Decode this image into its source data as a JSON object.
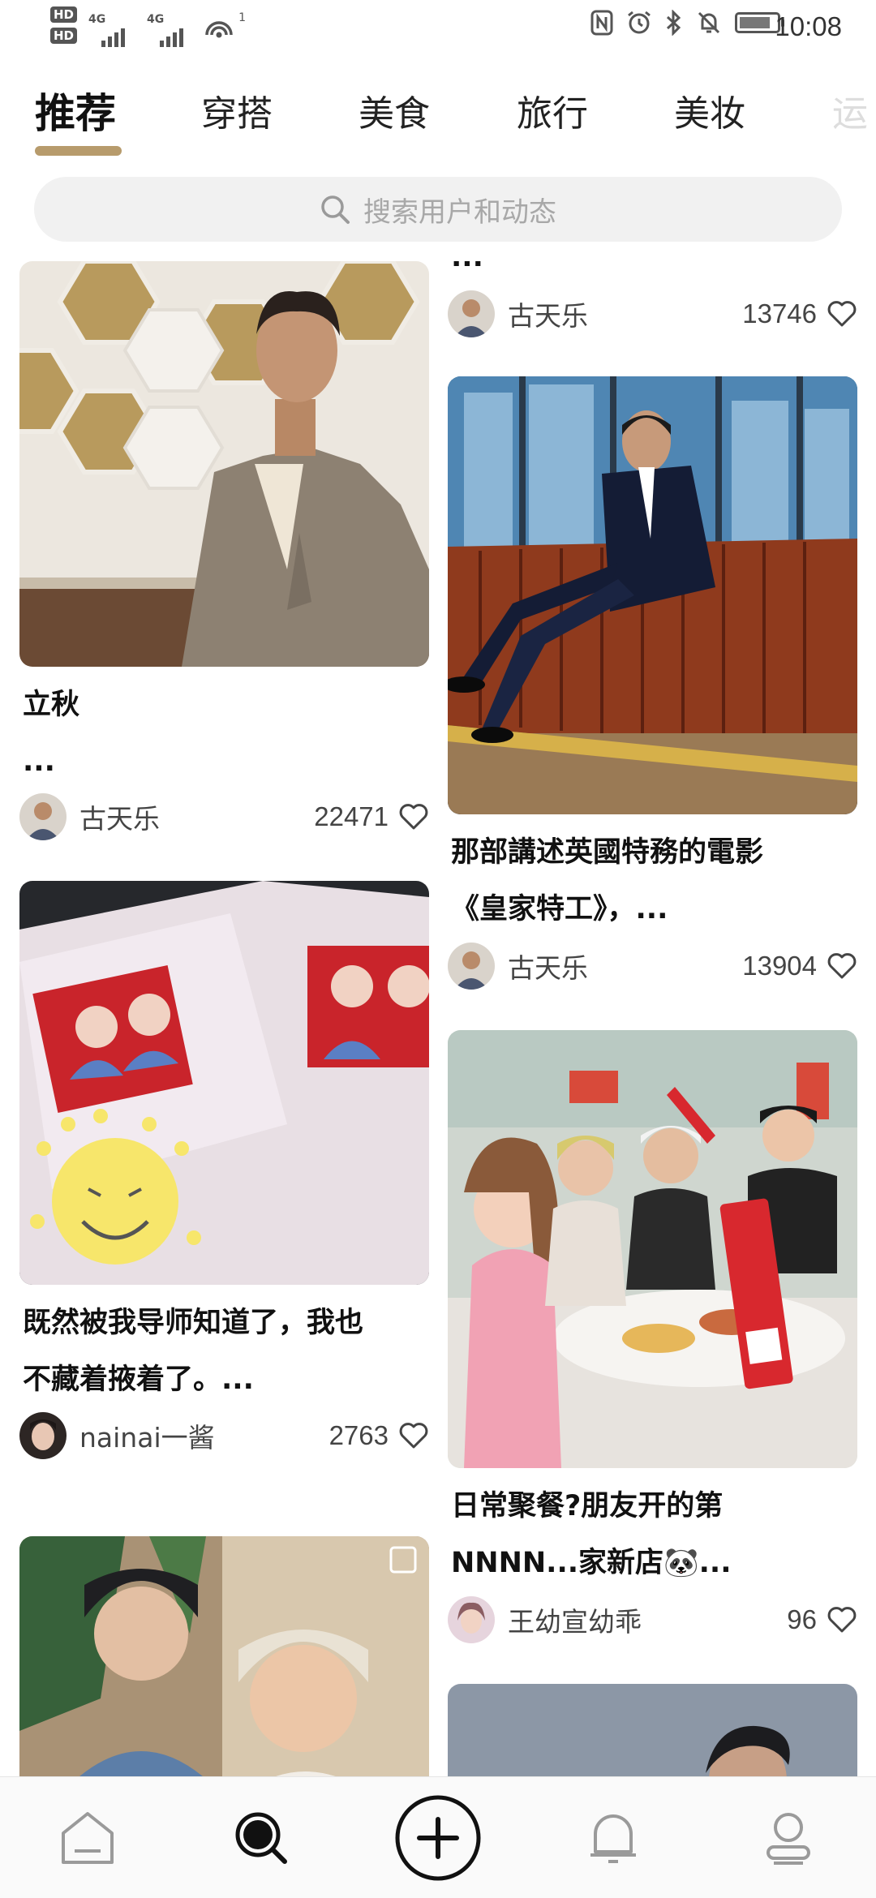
{
  "status_bar": {
    "hd1": "HD",
    "hd2": "HD",
    "net1": "4G",
    "net2": "4G",
    "wifi_badge": "1",
    "time": "10:08",
    "battery_level": 0.85
  },
  "tabs": [
    {
      "label": "推荐",
      "active": true
    },
    {
      "label": "穿搭",
      "active": false
    },
    {
      "label": "美食",
      "active": false
    },
    {
      "label": "旅行",
      "active": false
    },
    {
      "label": "美妆",
      "active": false
    },
    {
      "label": "运",
      "active": false
    }
  ],
  "search": {
    "placeholder": "搜索用户和动态",
    "icon": "search-icon"
  },
  "feed": {
    "left": [
      {
        "title": "立秋\n...",
        "author": "古天乐",
        "likes": "22471",
        "image": "man-in-tweed-suit-hexagon-wall"
      },
      {
        "title": "既然被我导师知道了，我也\n不藏着掖着了。...",
        "author": "nainai一酱",
        "likes": "2763",
        "image": "marriage-certificates-with-smiley-sticker"
      },
      {
        "image": "two-young-men-selfie-with-beanies"
      }
    ],
    "right": [
      {
        "title": "...",
        "author": "古天乐",
        "likes": "13746"
      },
      {
        "title": "那部講述英國特務的電影\n《皇家特工》，...",
        "author": "古天乐",
        "likes": "13904",
        "image": "man-in-tuxedo-on-leather-sofa"
      },
      {
        "title": "日常聚餐?朋友开的第\nNNNN...家新店🐼...",
        "author": "王幼宣幼乖",
        "likes": "96",
        "image": "friends-dining-at-restaurant"
      },
      {
        "image": "man-portrait-grey-background"
      }
    ]
  },
  "bottom_nav": [
    {
      "name": "home",
      "icon": "home-icon"
    },
    {
      "name": "discover",
      "icon": "search-icon",
      "active": true
    },
    {
      "name": "publish",
      "icon": "plus-icon"
    },
    {
      "name": "notifications",
      "icon": "bell-icon"
    },
    {
      "name": "profile",
      "icon": "user-icon"
    }
  ]
}
